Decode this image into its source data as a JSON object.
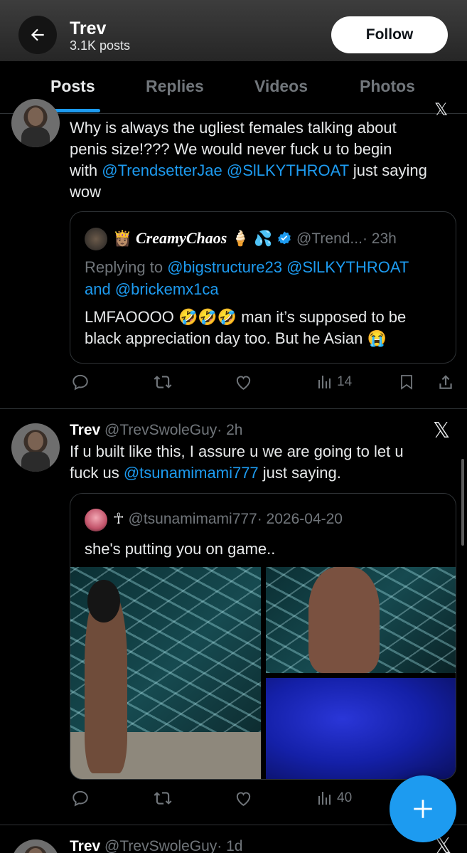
{
  "header": {
    "name": "Trev",
    "posts_count": "3.1K posts",
    "follow_label": "Follow"
  },
  "tabs": [
    "Posts",
    "Replies",
    "Videos",
    "Photos"
  ],
  "post1": {
    "text_line1": "Why is always the ugliest females talking about",
    "text_line2": "penis size!???  We would never fuck u to begin",
    "text_line3_pre": "with ",
    "mention1": "@TrendsetterJae",
    "mention2": "@SlLKYTHROAT",
    "text_line3_post": " just saying",
    "text_line4": "wow",
    "quote": {
      "emoji_prefix": "👸🏽",
      "display_name": "CreamyChaos",
      "emoji_suffix": "🍦 💦",
      "handle": "@Trend...",
      "time": "· 23h",
      "replying_to_label": "Replying to ",
      "reply_mention1": "@bigstructure23",
      "reply_mention2": "@SlLKYTHROAT",
      "and_label": "and ",
      "reply_mention3": "@brickemx1ca",
      "body_line1": "LMFAOOOO 🤣🤣🤣 man it’s supposed to be",
      "body_line2": "black appreciation day too. But he Asian 😭"
    },
    "views": "14"
  },
  "post2": {
    "name": "Trev",
    "handle": "@TrevSwoleGuy",
    "time": "· 2h",
    "text_line1": "If u built like this, I assure u we are going to let u",
    "text_line2_pre": "fuck us ",
    "mention": "@tsunamimami777",
    "text_line2_post": " just saying.",
    "quote": {
      "name_symbol": "☥",
      "handle": "@tsunamimami777",
      "date": "· 2026-04-20",
      "body": "she's putting you on game.."
    },
    "views": "40"
  },
  "post3": {
    "name": "Trev",
    "handle": "@TrevSwoleGuy",
    "time": "· 1d"
  },
  "colors": {
    "accent": "#1d9bf0",
    "text": "#e7e9ea",
    "muted": "#71767b",
    "background": "#000000"
  },
  "icons": [
    "back-arrow-icon",
    "x-logo-icon",
    "verified-badge-icon",
    "reply-icon",
    "repost-icon",
    "like-icon",
    "views-icon",
    "bookmark-icon",
    "share-icon",
    "compose-plus-icon"
  ]
}
